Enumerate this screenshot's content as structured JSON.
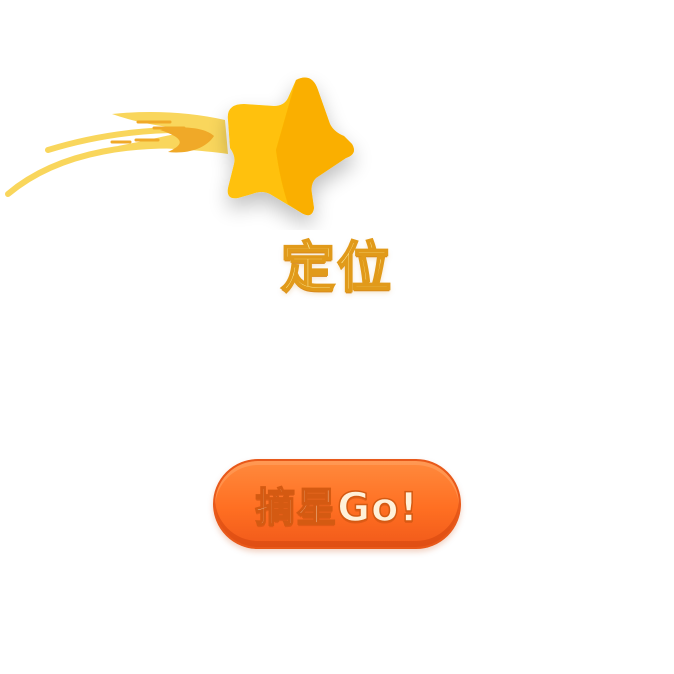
{
  "page": {
    "title": "定位",
    "button_label": "摘星Go!"
  },
  "icons": {
    "hero": "shooting-star-icon"
  },
  "colors": {
    "star_primary": "#ffc107",
    "star_shade": "#f5a000",
    "trail": "#f9d65c",
    "title_fill": "#fff3a6",
    "title_stroke": "#e19a1a",
    "button_top": "#ff8a3d",
    "button_bottom": "#f15a1a",
    "button_text": "#fff1d9"
  }
}
